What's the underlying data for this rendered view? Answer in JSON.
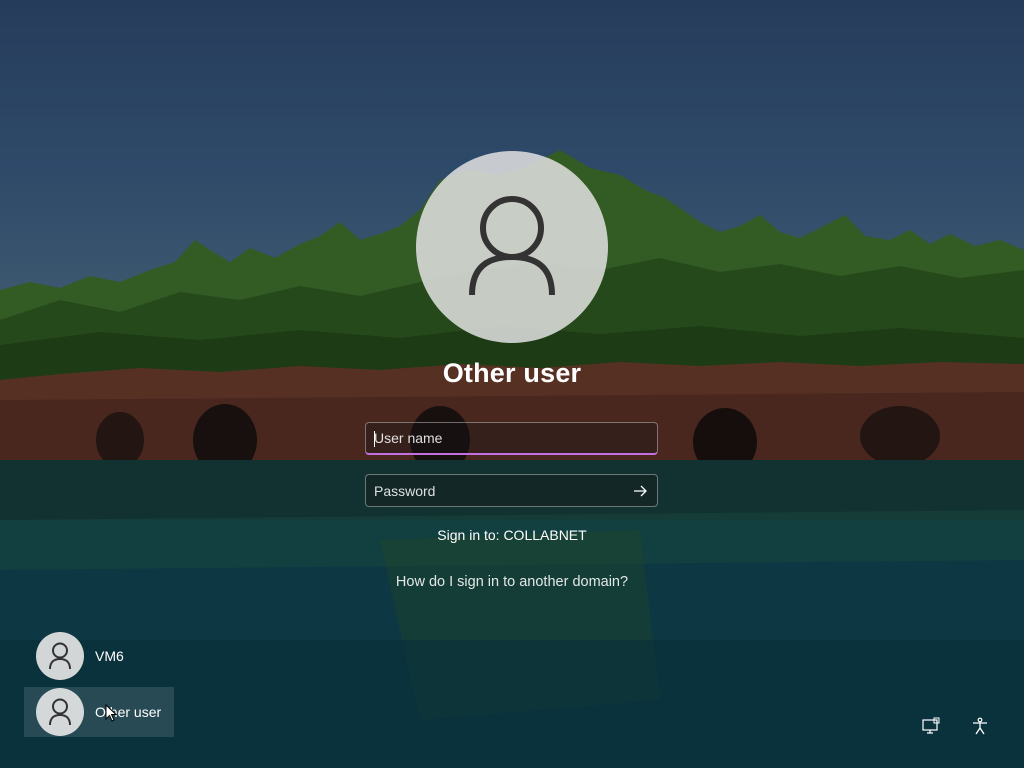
{
  "login": {
    "title": "Other user",
    "username_placeholder": "User name",
    "password_placeholder": "Password",
    "sign_in_to": "Sign in to: COLLABNET",
    "domain_help_link": "How do I sign in to another domain?"
  },
  "users": [
    {
      "name": "VM6",
      "selected": false
    },
    {
      "name": "Other user",
      "selected": true
    }
  ],
  "icons": {
    "big_avatar": "user-icon",
    "submit": "arrow-right-icon",
    "network": "network-icon",
    "accessibility": "accessibility-icon"
  },
  "colors": {
    "focus_accent": "#c36fe0",
    "avatar_fill": "#e1e1e1"
  }
}
